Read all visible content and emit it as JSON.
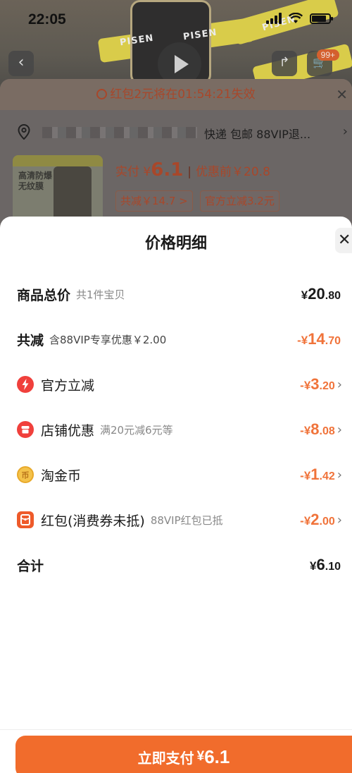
{
  "status_bar": {
    "time": "22:05"
  },
  "background": {
    "brand_marks": [
      "PISEN",
      "PISEN",
      "PISEN"
    ],
    "cart_badge": "99+",
    "coupon_banner": "红包2元将在01:54:21失效",
    "address_suffix": "快递 包邮 88VIP退...",
    "product_thumb_text": "高清防爆\n无纹膜",
    "actual_pay_label": "实付 ¥",
    "actual_pay_value": "6.1",
    "before_discount": "优惠前￥20.8",
    "chip_total_reduction": "共减￥14.7 >",
    "chip_official": "官方立减3.2元"
  },
  "sheet": {
    "title": "价格明细",
    "close_label": "✕",
    "rows": [
      {
        "label": "商品总价",
        "sub": "共1件宝贝",
        "currency": "¥",
        "int": "20",
        "dec": ".80"
      },
      {
        "label": "共减",
        "sub": "含88VIP专享优惠￥2.00",
        "currency": "-¥",
        "int": "14",
        "dec": ".70"
      },
      {
        "label": "官方立减",
        "sub": "",
        "currency": "-¥",
        "int": "3",
        "dec": ".20",
        "icon": "lightning-icon"
      },
      {
        "label": "店铺优惠",
        "sub": "满20元减6元等",
        "currency": "-¥",
        "int": "8",
        "dec": ".08",
        "icon": "shop-icon"
      },
      {
        "label": "淘金币",
        "sub": "",
        "currency": "-¥",
        "int": "1",
        "dec": ".42",
        "icon": "coin-icon"
      },
      {
        "label": "红包(消费券未抵)",
        "sub": "88VIP红包已抵",
        "currency": "-¥",
        "int": "2",
        "dec": ".00",
        "icon": "red-packet-icon"
      },
      {
        "label": "合计",
        "sub": "",
        "currency": "¥",
        "int": "6",
        "dec": ".10"
      }
    ]
  },
  "pay_button": {
    "label": "立即支付",
    "currency": "¥",
    "amount": "6.1"
  },
  "colors": {
    "accent": "#f16c2c",
    "discount": "#f0733a",
    "icon_red": "#f0403c",
    "coin": "#f4c24a"
  }
}
